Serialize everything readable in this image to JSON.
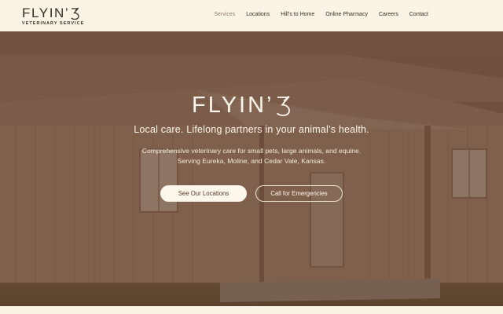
{
  "header": {
    "logo_word": "FLYIN’",
    "logo_subtitle": "VETERINARY SERVICE",
    "nav": [
      {
        "label": "Services",
        "active": true
      },
      {
        "label": "Locations",
        "active": false
      },
      {
        "label": "Hill’s to Home",
        "active": false
      },
      {
        "label": "Online Pharmacy",
        "active": false
      },
      {
        "label": "Careers",
        "active": false
      },
      {
        "label": "Contact",
        "active": false
      }
    ]
  },
  "hero": {
    "logo_word": "FLYIN’",
    "tagline": "Local care. Lifelong partners in your animal’s health.",
    "description_line1": "Comprehensive veterinary care for small pets, large animals, and equine.",
    "description_line2": "Serving Eureka, Moline, and Cedar Vale, Kansas.",
    "primary_button": "See Our Locations",
    "secondary_button": "Call for Emergencies"
  },
  "colors": {
    "background": "#fbf3e6",
    "overlay": "#5c3e2e",
    "text_dark": "#3a2c22",
    "text_light": "#fdf6ea"
  }
}
